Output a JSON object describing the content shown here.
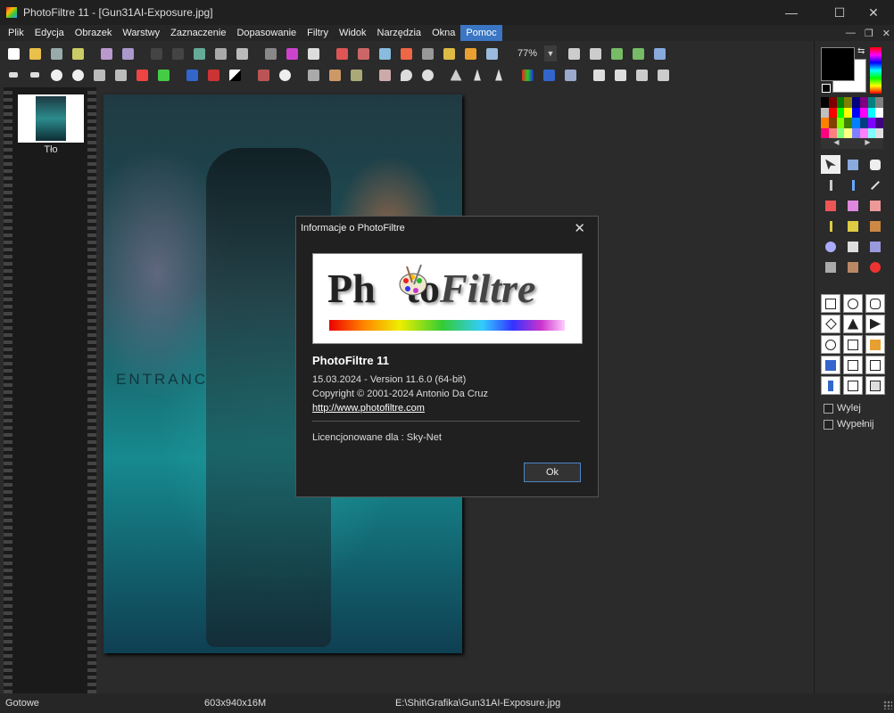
{
  "window": {
    "title": "PhotoFiltre 11 - [Gun31AI-Exposure.jpg]",
    "minimize": "—",
    "maximize": "☐",
    "close": "✕"
  },
  "menu": [
    "Plik",
    "Edycja",
    "Obrazek",
    "Warstwy",
    "Zaznaczenie",
    "Dopasowanie",
    "Filtry",
    "Widok",
    "Narzędzia",
    "Okna",
    "Pomoc"
  ],
  "active_menu": "Pomoc",
  "mdi_controls": {
    "minimize": "—",
    "restore": "❐",
    "close": "✕"
  },
  "toolbar": {
    "zoom": "77%",
    "zoom_arrow": "▼"
  },
  "layers": {
    "name": "Tło"
  },
  "image": {
    "sign_text": "ENTRANC"
  },
  "dialog": {
    "title": "Informacje o PhotoFiltre",
    "close": "✕",
    "logo_part1": "Ph",
    "logo_part2": "to",
    "logo_part3": "Filtre",
    "app_name": "PhotoFiltre 11",
    "version": "15.03.2024 - Version 11.6.0 (64-bit)",
    "copyright": "Copyright © 2001-2024  Antonio Da Cruz",
    "url": "http://www.photofiltre.com",
    "license": "Licencjonowane dla : Sky-Net",
    "ok": "Ok"
  },
  "palette_nav": {
    "left": "◀",
    "right": "▶"
  },
  "swap_symbol": "⇆",
  "swatch_colors": [
    "#000000",
    "#800000",
    "#008000",
    "#808000",
    "#000080",
    "#800080",
    "#008080",
    "#808080",
    "#c0c0c0",
    "#ff0000",
    "#00ff00",
    "#ffff00",
    "#0000ff",
    "#ff00ff",
    "#00ffff",
    "#ffffff",
    "#ff8000",
    "#804000",
    "#80ff00",
    "#408000",
    "#0080ff",
    "#004080",
    "#8000ff",
    "#400080",
    "#ff0080",
    "#ff8080",
    "#80ff80",
    "#ffff80",
    "#8080ff",
    "#ff80ff",
    "#80ffff",
    "#e0e0e0"
  ],
  "options": {
    "fill_off": "Wylej",
    "fill_on": "Wypełnij"
  },
  "status": {
    "state": "Gotowe",
    "size": "603x940x16M",
    "path": "E:\\Shit\\Grafika\\Gun31AI-Exposure.jpg"
  }
}
